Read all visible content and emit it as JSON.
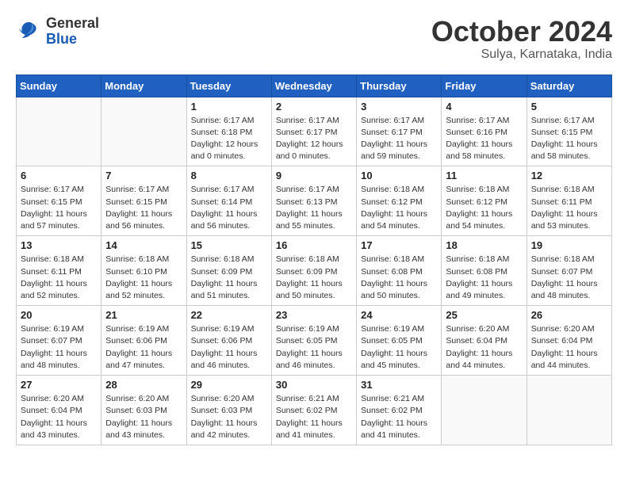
{
  "logo": {
    "general": "General",
    "blue": "Blue"
  },
  "title": "October 2024",
  "location": "Sulya, Karnataka, India",
  "headers": [
    "Sunday",
    "Monday",
    "Tuesday",
    "Wednesday",
    "Thursday",
    "Friday",
    "Saturday"
  ],
  "weeks": [
    [
      {
        "day": "",
        "info": ""
      },
      {
        "day": "",
        "info": ""
      },
      {
        "day": "1",
        "info": "Sunrise: 6:17 AM\nSunset: 6:18 PM\nDaylight: 12 hours\nand 0 minutes."
      },
      {
        "day": "2",
        "info": "Sunrise: 6:17 AM\nSunset: 6:17 PM\nDaylight: 12 hours\nand 0 minutes."
      },
      {
        "day": "3",
        "info": "Sunrise: 6:17 AM\nSunset: 6:17 PM\nDaylight: 11 hours\nand 59 minutes."
      },
      {
        "day": "4",
        "info": "Sunrise: 6:17 AM\nSunset: 6:16 PM\nDaylight: 11 hours\nand 58 minutes."
      },
      {
        "day": "5",
        "info": "Sunrise: 6:17 AM\nSunset: 6:15 PM\nDaylight: 11 hours\nand 58 minutes."
      }
    ],
    [
      {
        "day": "6",
        "info": "Sunrise: 6:17 AM\nSunset: 6:15 PM\nDaylight: 11 hours\nand 57 minutes."
      },
      {
        "day": "7",
        "info": "Sunrise: 6:17 AM\nSunset: 6:15 PM\nDaylight: 11 hours\nand 56 minutes."
      },
      {
        "day": "8",
        "info": "Sunrise: 6:17 AM\nSunset: 6:14 PM\nDaylight: 11 hours\nand 56 minutes."
      },
      {
        "day": "9",
        "info": "Sunrise: 6:17 AM\nSunset: 6:13 PM\nDaylight: 11 hours\nand 55 minutes."
      },
      {
        "day": "10",
        "info": "Sunrise: 6:18 AM\nSunset: 6:12 PM\nDaylight: 11 hours\nand 54 minutes."
      },
      {
        "day": "11",
        "info": "Sunrise: 6:18 AM\nSunset: 6:12 PM\nDaylight: 11 hours\nand 54 minutes."
      },
      {
        "day": "12",
        "info": "Sunrise: 6:18 AM\nSunset: 6:11 PM\nDaylight: 11 hours\nand 53 minutes."
      }
    ],
    [
      {
        "day": "13",
        "info": "Sunrise: 6:18 AM\nSunset: 6:11 PM\nDaylight: 11 hours\nand 52 minutes."
      },
      {
        "day": "14",
        "info": "Sunrise: 6:18 AM\nSunset: 6:10 PM\nDaylight: 11 hours\nand 52 minutes."
      },
      {
        "day": "15",
        "info": "Sunrise: 6:18 AM\nSunset: 6:09 PM\nDaylight: 11 hours\nand 51 minutes."
      },
      {
        "day": "16",
        "info": "Sunrise: 6:18 AM\nSunset: 6:09 PM\nDaylight: 11 hours\nand 50 minutes."
      },
      {
        "day": "17",
        "info": "Sunrise: 6:18 AM\nSunset: 6:08 PM\nDaylight: 11 hours\nand 50 minutes."
      },
      {
        "day": "18",
        "info": "Sunrise: 6:18 AM\nSunset: 6:08 PM\nDaylight: 11 hours\nand 49 minutes."
      },
      {
        "day": "19",
        "info": "Sunrise: 6:18 AM\nSunset: 6:07 PM\nDaylight: 11 hours\nand 48 minutes."
      }
    ],
    [
      {
        "day": "20",
        "info": "Sunrise: 6:19 AM\nSunset: 6:07 PM\nDaylight: 11 hours\nand 48 minutes."
      },
      {
        "day": "21",
        "info": "Sunrise: 6:19 AM\nSunset: 6:06 PM\nDaylight: 11 hours\nand 47 minutes."
      },
      {
        "day": "22",
        "info": "Sunrise: 6:19 AM\nSunset: 6:06 PM\nDaylight: 11 hours\nand 46 minutes."
      },
      {
        "day": "23",
        "info": "Sunrise: 6:19 AM\nSunset: 6:05 PM\nDaylight: 11 hours\nand 46 minutes."
      },
      {
        "day": "24",
        "info": "Sunrise: 6:19 AM\nSunset: 6:05 PM\nDaylight: 11 hours\nand 45 minutes."
      },
      {
        "day": "25",
        "info": "Sunrise: 6:20 AM\nSunset: 6:04 PM\nDaylight: 11 hours\nand 44 minutes."
      },
      {
        "day": "26",
        "info": "Sunrise: 6:20 AM\nSunset: 6:04 PM\nDaylight: 11 hours\nand 44 minutes."
      }
    ],
    [
      {
        "day": "27",
        "info": "Sunrise: 6:20 AM\nSunset: 6:04 PM\nDaylight: 11 hours\nand 43 minutes."
      },
      {
        "day": "28",
        "info": "Sunrise: 6:20 AM\nSunset: 6:03 PM\nDaylight: 11 hours\nand 43 minutes."
      },
      {
        "day": "29",
        "info": "Sunrise: 6:20 AM\nSunset: 6:03 PM\nDaylight: 11 hours\nand 42 minutes."
      },
      {
        "day": "30",
        "info": "Sunrise: 6:21 AM\nSunset: 6:02 PM\nDaylight: 11 hours\nand 41 minutes."
      },
      {
        "day": "31",
        "info": "Sunrise: 6:21 AM\nSunset: 6:02 PM\nDaylight: 11 hours\nand 41 minutes."
      },
      {
        "day": "",
        "info": ""
      },
      {
        "day": "",
        "info": ""
      }
    ]
  ]
}
